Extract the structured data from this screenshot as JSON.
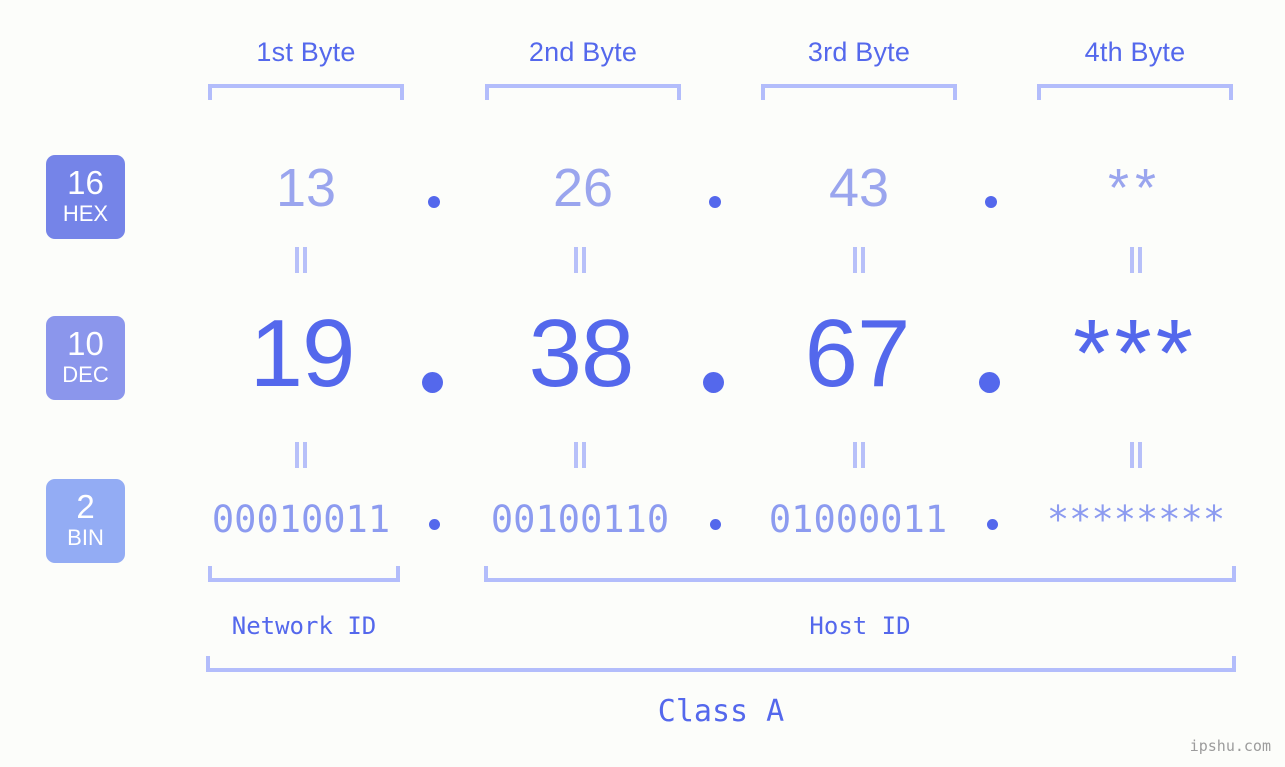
{
  "colors": {
    "background": "#fcfdfa",
    "accent_strong": "#5468ec",
    "accent_mid": "#8c9bf0",
    "accent_light": "#b3bdfb",
    "badge_hex": "#7584e8",
    "badge_dec": "#8b96ec",
    "badge_bin": "#93acf4",
    "watermark": "#9c9c9c"
  },
  "byte_headers": [
    {
      "label": "1st Byte"
    },
    {
      "label": "2nd Byte"
    },
    {
      "label": "3rd Byte"
    },
    {
      "label": "4th Byte"
    }
  ],
  "bases": [
    {
      "number": "16",
      "unit": "HEX"
    },
    {
      "number": "10",
      "unit": "DEC"
    },
    {
      "number": "2",
      "unit": "BIN"
    }
  ],
  "rows": {
    "hex": {
      "values": [
        "13",
        "26",
        "43",
        "**"
      ],
      "separator": "."
    },
    "dec": {
      "values": [
        "19",
        "38",
        "67",
        "***"
      ],
      "separator": "."
    },
    "bin": {
      "values": [
        "00010011",
        "00100110",
        "01000011",
        "********"
      ],
      "separator": "."
    }
  },
  "equals_marks": {
    "symbol": "||",
    "count_per_row": 4,
    "rows": 2
  },
  "sections": [
    {
      "label": "Network ID"
    },
    {
      "label": "Host ID"
    }
  ],
  "class": {
    "label": "Class A"
  },
  "watermark": {
    "text": "ipshu.com"
  }
}
